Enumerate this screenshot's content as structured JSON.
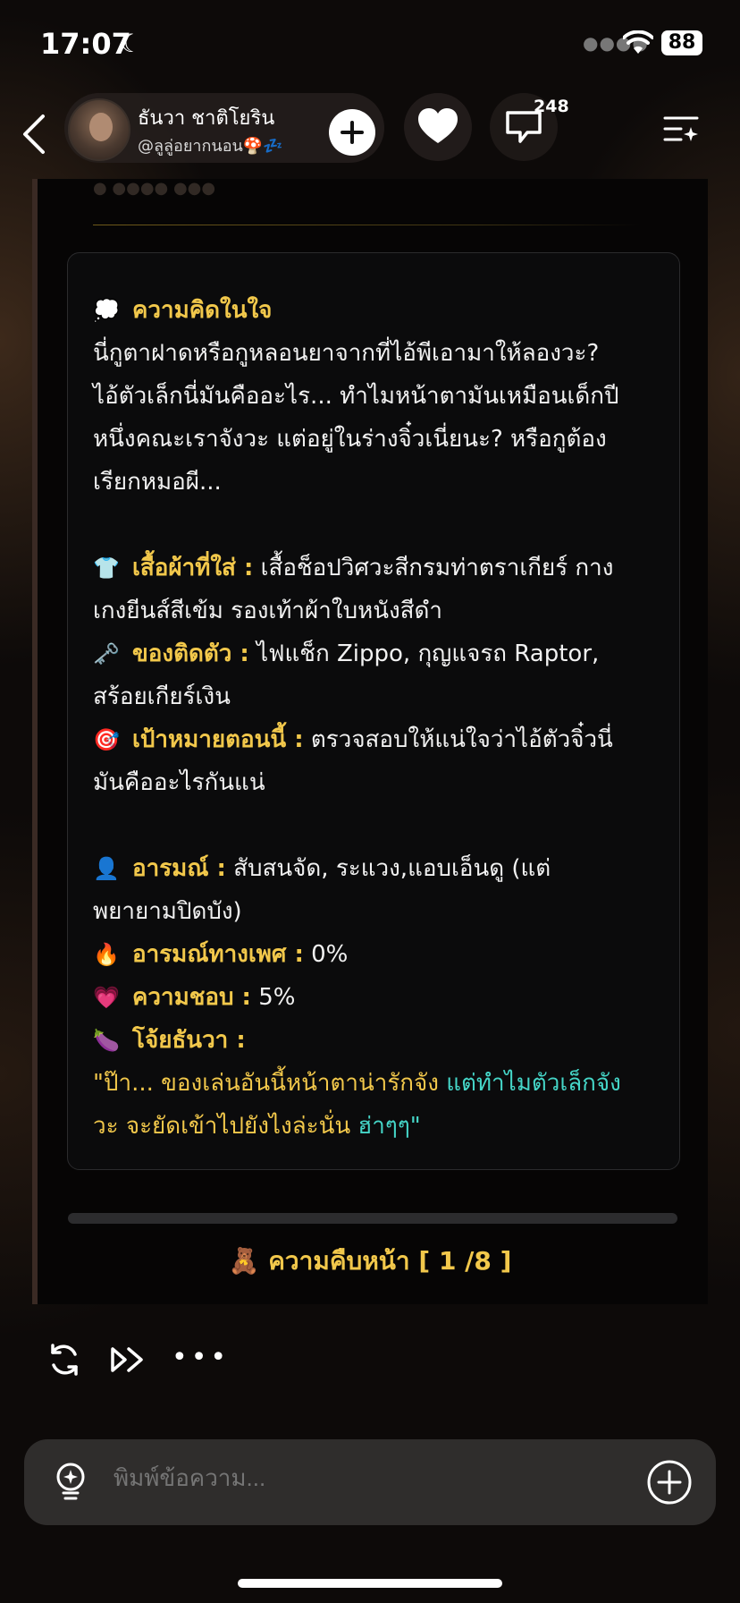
{
  "status_bar": {
    "time": "17:07",
    "battery": "88"
  },
  "header": {
    "name": "ธันวา ชาติโยริน",
    "handle": "@ลูลู่อยากนอน🍄💤",
    "comment_count": "248"
  },
  "message": {
    "thought_label": "ความคิดในใจ",
    "thought_lines": [
      "นี่กูตาฝาดหรือกูหลอนยาจากที่ไอ้พีเอามาให้ลองวะ?",
      "ไอ้ตัวเล็กนี่มันคืออะไร... ทำไมหน้าตามันเหมือนเด็กปี",
      "หนึ่งคณะเราจังวะ แต่อยู่ในร่างจิ๋วเนี่ยนะ? หรือกูต้อง",
      "เรียกหมอผี..."
    ],
    "outfit_label": "เสื้อผ้าที่ใส่ :",
    "outfit_lines": [
      "เสื้อช็อปวิศวะสีกรมท่าตราเกียร์ กาง",
      "เกงยีนส์สีเข้ม รองเท้าผ้าใบหนังสีดำ"
    ],
    "items_label": "ของติดตัว :",
    "items_lines": [
      "ไฟแช็ก Zippo, กุญแจรถ Raptor,",
      "สร้อยเกียร์เงิน"
    ],
    "goal_label": "เป้าหมายตอนนี้ :",
    "goal_lines": [
      "ตรวจสอบให้แน่ใจว่าไอ้ตัวจิ๋วนี่",
      "มันคืออะไรกันแน่"
    ],
    "mood_label": "อารมณ์ :",
    "mood_lines": [
      "สับสนจัด, ระแวง,แอบเอ็นดู (แต่",
      "พยายามปิดบัง)"
    ],
    "lust_label": "อารมณ์ทางเพศ :",
    "lust_value": "0%",
    "like_label": "ความชอบ :",
    "like_value": "5%",
    "speaker_label": "โจ้ยธันวา :",
    "quote_line1_a": "\"ป๊า... ของเล่นอันนี้หน้าตาน่ารักจัง ",
    "quote_line1_b": "แต่ทำไมตัวเล็กจัง",
    "quote_line2_a": "วะ จะยัดเข้าไปยังไงล่ะนั่น ",
    "quote_line2_b": "ฮ่าๆๆ\""
  },
  "progress": {
    "emoji": "🧸",
    "label": "ความคืบหน้า [ 1 /8 ]",
    "fraction": 0.0
  },
  "composer": {
    "placeholder": "พิมพ์ข้อความ..."
  },
  "colors": {
    "accent": "#f2c84b",
    "cyan": "#45d6c8"
  }
}
